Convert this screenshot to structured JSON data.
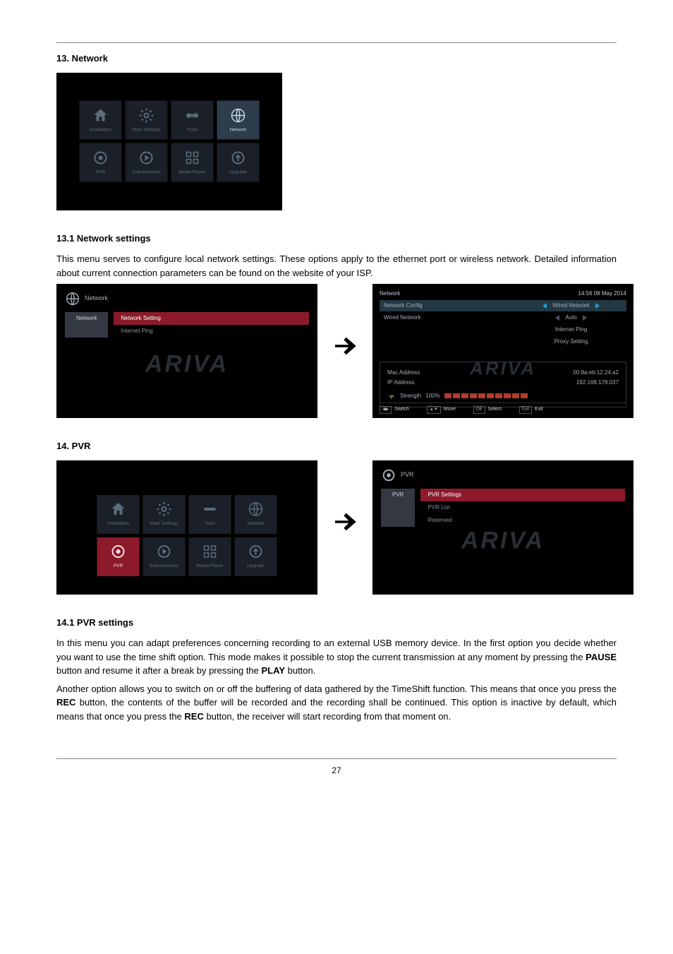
{
  "sections": {
    "network_title": "13. Network",
    "network_settings_title": "13.1 Network settings",
    "network_settings_body": "This menu serves to configure local network settings. These options apply to the ethernet port or wireless network. Detailed information about current connection parameters can be found on the website of your ISP.",
    "pvr_title": "14. PVR",
    "pvr_settings_title": "14.1 PVR settings",
    "pvr_body_1_a": "In this menu you can adapt preferences concerning recording to an external USB memory device. In the first option you decide whether you want to use the time shift option. This mode makes it possible to stop the current transmission at any moment by pressing the ",
    "pause": "PAUSE",
    "pvr_body_1_b": " button and resume it after a break by pressing the ",
    "play": "PLAY",
    "pvr_body_1_c": " button.",
    "pvr_body_2_a": "Another option allows you to switch on or off the buffering of data gathered by the TimeShift function. This means that once you press the ",
    "rec": "REC",
    "pvr_body_2_b": " button, the contents of the buffer will be recorded and the recording shall be continued. This option is inactive by default, which means that once you press the ",
    "pvr_body_2_c": " button, the receiver will start recording from that moment on."
  },
  "menu_tiles": {
    "installation": "Installation",
    "main_settings": "Main Settings",
    "tools": "Tools",
    "network": "Network",
    "pvr": "PVR",
    "entertainment": "Entertainment",
    "media_player": "Media Player",
    "upgrade": "Upgrade"
  },
  "network_sub": {
    "header": "Network",
    "tab": "Network",
    "opt1": "Network Setting",
    "opt2": "Internet Ping"
  },
  "network_cfg": {
    "title": "Network",
    "datetime": "14:56 08 May 2014",
    "row1_label": "Network Config",
    "row1_value": "Wired Network",
    "row2_label": "Wired Network",
    "row2_value": "Auto",
    "row3": "Internet Ping",
    "row4": "Proxy Setting",
    "mac_label": "Mac Address",
    "mac_value": "00:8a:eb:12:24:a2",
    "ip_label": "IP Address",
    "ip_value": "192.168.178.037",
    "strength_label": "Strength",
    "strength_value": "100%",
    "f_switch": "Switch",
    "f_move": "Move",
    "f_select": "Select",
    "f_exit": "Exit",
    "k_lr": "◀▶",
    "k_ud": "▲▼",
    "k_ok": "OK",
    "k_exit": "Exit"
  },
  "pvr_sub": {
    "header": "PVR",
    "tab": "PVR",
    "opt1": "PVR Settings",
    "opt2": "PVR List",
    "opt3": "Reserved"
  },
  "watermark": "ARIVA",
  "page_number": "27"
}
